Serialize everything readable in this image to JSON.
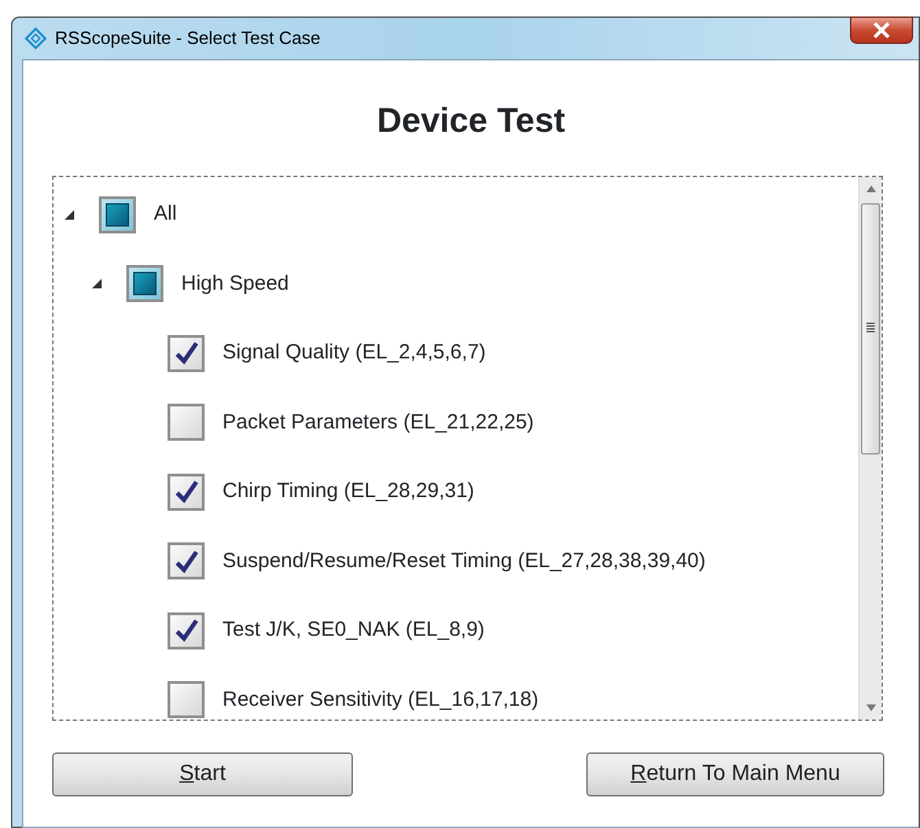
{
  "window": {
    "title": "RSScopeSuite - Select Test Case"
  },
  "heading": "Device Test",
  "tree": [
    {
      "label": "All",
      "checked": false,
      "indeterminate": true,
      "expanded": true,
      "children": [
        {
          "label": "High Speed",
          "checked": false,
          "indeterminate": true,
          "expanded": true,
          "children": [
            {
              "label": "Signal Quality (EL_2,4,5,6,7)",
              "checked": true
            },
            {
              "label": "Packet Parameters (EL_21,22,25)",
              "checked": false
            },
            {
              "label": "Chirp Timing (EL_28,29,31)",
              "checked": true
            },
            {
              "label": "Suspend/Resume/Reset Timing (EL_27,28,38,39,40)",
              "checked": true
            },
            {
              "label": "Test J/K, SE0_NAK (EL_8,9)",
              "checked": true
            },
            {
              "label": "Receiver Sensitivity (EL_16,17,18)",
              "checked": false
            }
          ]
        }
      ]
    }
  ],
  "buttons": [
    {
      "label": "Start",
      "first_letter_underlined": true
    },
    {
      "label": "Return To Main Menu",
      "first_letter_underlined": true
    }
  ]
}
